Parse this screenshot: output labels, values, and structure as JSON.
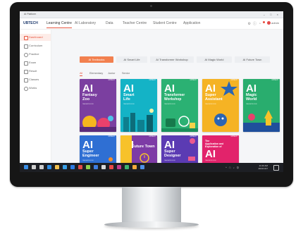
{
  "window": {
    "title": "AI Platform",
    "controls": "– □ ×"
  },
  "app": {
    "logo": "UBTECH"
  },
  "topnav": {
    "items": [
      {
        "label": "Learning Centre",
        "active": true
      },
      {
        "label": "AI Laboratory",
        "active": false
      },
      {
        "label": "Data",
        "active": false
      },
      {
        "label": "Teacher Centre",
        "active": false
      },
      {
        "label": "Student Centre",
        "active": false
      },
      {
        "label": "Application",
        "active": false
      }
    ],
    "icons": [
      "settings-icon",
      "help-icon",
      "notification-icon"
    ],
    "user_name": "admin"
  },
  "sidebar": {
    "items": [
      {
        "label": "Dashboard",
        "icon": "dashboard-icon",
        "active": true
      },
      {
        "label": "Curriculum",
        "icon": "curriculum-icon",
        "active": false
      },
      {
        "label": "Practice",
        "icon": "practice-icon",
        "active": false
      },
      {
        "label": "Exam",
        "icon": "exam-icon",
        "active": false
      },
      {
        "label": "Result",
        "icon": "result-icon",
        "active": false
      },
      {
        "label": "Classes",
        "icon": "classes-icon",
        "active": false
      },
      {
        "label": "Works",
        "icon": "works-icon",
        "active": false
      }
    ]
  },
  "series_tabs": [
    {
      "label": "AI Textbooks",
      "active": true
    },
    {
      "label": "AI Smart Life",
      "active": false
    },
    {
      "label": "AI Transformer Workshop",
      "active": false
    },
    {
      "label": "AI Magic World",
      "active": false
    },
    {
      "label": "AI Future Town",
      "active": false
    }
  ],
  "level_filters": [
    {
      "label": "All",
      "active": true
    },
    {
      "label": "Elementary",
      "active": false
    },
    {
      "label": "Junior",
      "active": false
    },
    {
      "label": "Senior",
      "active": false
    }
  ],
  "books": [
    {
      "ai": "AI",
      "title": "Fantasy\nZoo",
      "subtitle": "TEACHER'S BOOK",
      "brand": "UBTECH",
      "bg": "#7b3fa0",
      "accent": "#f6b61e"
    },
    {
      "ai": "AI",
      "title": "Smart\nLife",
      "subtitle": "TEACHER'S BOOK",
      "brand": "UBTECH",
      "bg": "#14b3c6",
      "accent": "#0e7f8f"
    },
    {
      "ai": "AI",
      "title": "Transformer\nWorkshop",
      "subtitle": "TEACHER'S BOOK",
      "brand": "UBTECH",
      "bg": "#2bb173",
      "accent": "#167a4c"
    },
    {
      "ai": "AI",
      "title": "Super\nAssistant",
      "subtitle": "TEACHER'S BOOK",
      "brand": "UBTECH",
      "bg": "#f5b324",
      "accent": "#2a65b3"
    },
    {
      "ai": "AI",
      "title": "Magic\nWorld",
      "subtitle": "TEACHER'S BOOK",
      "brand": "UBTECH",
      "bg": "#29ad6e",
      "accent": "#1f4f9c"
    },
    {
      "ai": "AI",
      "title": "Super\nEngineer",
      "subtitle": "TEACHER'S BOOK",
      "brand": "UBTECH",
      "bg": "#2f6fd3",
      "accent": "#f18c2a"
    },
    {
      "ai": "AI",
      "title": "Future\nTown",
      "subtitle": "TEACHER'S BOOK",
      "brand": "UBTECH",
      "bg": "#7d3ba6",
      "accent": "#f7c22a"
    },
    {
      "ai": "AI",
      "title": "Super\nDesigner",
      "subtitle": "TEACHER'S BOOK",
      "brand": "UBTECH",
      "bg": "#5b3bb3",
      "accent": "#ec5b8e"
    },
    {
      "ai": "AI",
      "title": "The\nApplication and\nExploration of",
      "subtitle": "TEACHER'S BOOK",
      "brand": "UBTECH",
      "bg": "#e2236b",
      "accent": "#8e1747"
    }
  ],
  "taskbar": {
    "apps": [
      "start-icon",
      "search-icon",
      "task-view-icon",
      "edge-icon",
      "explorer-icon",
      "store-icon",
      "mail-icon",
      "media-icon",
      "settings-icon",
      "app-icon",
      "app-icon",
      "app-icon",
      "app-icon",
      "app-icon",
      "app-icon",
      "app-icon"
    ],
    "app_colors": [
      "#3a8ee6",
      "#cfcfcf",
      "#cfcfcf",
      "#2f8de4",
      "#f2c14e",
      "#3aa0e8",
      "#2c7be5",
      "#e24a4a",
      "#8fd14f",
      "#3f7de0",
      "#d9d9d9",
      "#e94848",
      "#c23b8c",
      "#3fb46d",
      "#f3a93a",
      "#4d8fe8"
    ],
    "time": "11:00 AM",
    "date": "2021/1/27",
    "tray_icons": "^ ☁ ♪ 中"
  }
}
